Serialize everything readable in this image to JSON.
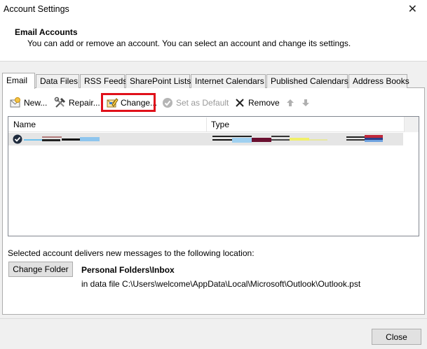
{
  "window": {
    "title": "Account Settings",
    "close_glyph": "✕"
  },
  "header": {
    "title": "Email Accounts",
    "description": "You can add or remove an account. You can select an account and change its settings."
  },
  "tabs": [
    {
      "label": "Email",
      "active": true
    },
    {
      "label": "Data Files",
      "active": false
    },
    {
      "label": "RSS Feeds",
      "active": false
    },
    {
      "label": "SharePoint Lists",
      "active": false
    },
    {
      "label": "Internet Calendars",
      "active": false
    },
    {
      "label": "Published Calendars",
      "active": false
    },
    {
      "label": "Address Books",
      "active": false
    }
  ],
  "toolbar": {
    "new_label": "New...",
    "repair_label": "Repair...",
    "change_label": "Change...",
    "set_default_label": "Set as Default",
    "remove_label": "Remove",
    "highlight_color": "#e0101a"
  },
  "account_list": {
    "columns": [
      "Name",
      "Type"
    ]
  },
  "delivery": {
    "text": "Selected account delivers new messages to the following location:",
    "change_folder_label": "Change Folder",
    "location_title": "Personal Folders\\Inbox",
    "location_path": "in data file C:\\Users\\welcome\\AppData\\Local\\Microsoft\\Outlook\\Outlook.pst"
  },
  "footer": {
    "close_label": "Close"
  }
}
